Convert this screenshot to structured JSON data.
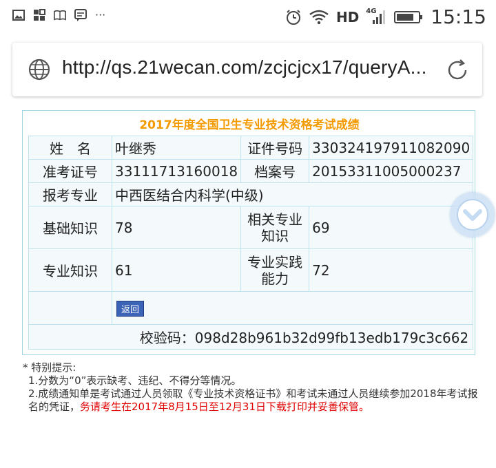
{
  "status_bar": {
    "network": "HD",
    "signal_type": "4G",
    "time": "15:15",
    "icons": [
      "image-icon",
      "apps-icon",
      "book-icon",
      "message-icon",
      "more-icon",
      "alarm-icon",
      "wifi-icon",
      "signal-icon",
      "battery-icon"
    ],
    "overflow": "···"
  },
  "browser": {
    "url": "http://qs.21wecan.com/zcjcjcx17/queryA..."
  },
  "result": {
    "title": "2017年度全国卫生专业技术资格考试成绩",
    "name_label": "姓　名",
    "name_value": "叶继秀",
    "id_label": "证件号码",
    "id_value": "330324197911082090",
    "ticket_label": "准考证号",
    "ticket_value": "33111713160018",
    "file_label": "档案号",
    "file_value": "20153311005000237",
    "major_label": "报考专业",
    "major_value": "中西医结合内科学(中级)",
    "basic_label": "基础知识",
    "basic_score": "78",
    "related_label_1": "相关专业",
    "related_label_2": "知识",
    "related_score": "69",
    "professional_label": "专业知识",
    "professional_score": "61",
    "practice_label_1": "专业实践",
    "practice_label_2": "能力",
    "practice_score": "72",
    "back_button": "返回",
    "verify_label": "校验码：",
    "verify_code": "098d28b961b32d99fb13edb179c3c662"
  },
  "notes": {
    "heading": "* 特别提示:",
    "item1": "1.分数为“0”表示缺考、违纪、不得分等情况。",
    "item2_part1": "2.成绩通知单是考试通过人员领取《专业技术资格证书》和考试未通过人员继续参加2018年考试报名的凭证，",
    "item2_part2": "务请考生在2017年8月15日至12月31日下载打印并妥善保管。"
  }
}
